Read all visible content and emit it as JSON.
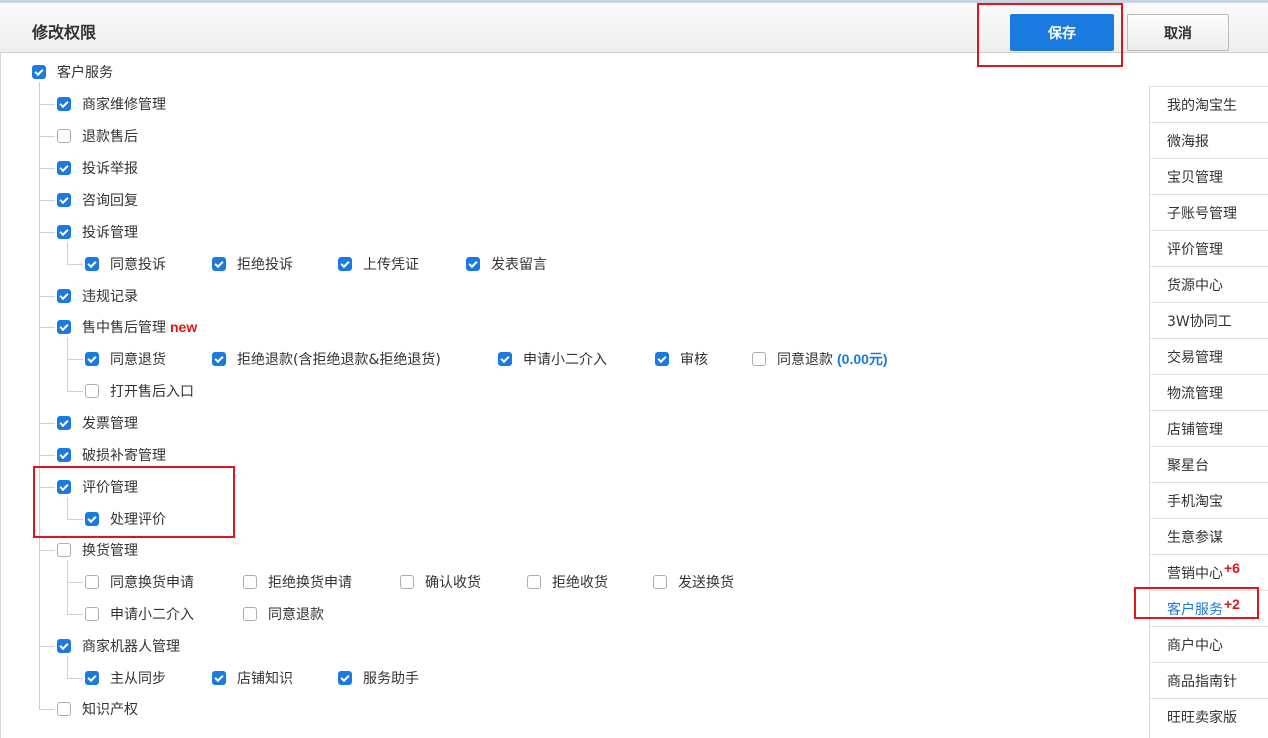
{
  "header": {
    "title": "修改权限",
    "save_label": "保存",
    "cancel_label": "取消"
  },
  "colors": {
    "accent": "#1a7ae0",
    "highlight": "#e0141c",
    "new_tag": "#e0141c"
  },
  "tree": {
    "root": {
      "label": "客户服务",
      "checked": true
    },
    "items": [
      {
        "label": "商家维修管理",
        "checked": true
      },
      {
        "label": "退款售后",
        "checked": false
      },
      {
        "label": "投诉举报",
        "checked": true
      },
      {
        "label": "咨询回复",
        "checked": true
      },
      {
        "label": "投诉管理",
        "checked": true,
        "children": [
          {
            "label": "同意投诉",
            "checked": true
          },
          {
            "label": "拒绝投诉",
            "checked": true
          },
          {
            "label": "上传凭证",
            "checked": true
          },
          {
            "label": "发表留言",
            "checked": true
          }
        ]
      },
      {
        "label": "违规记录",
        "checked": true
      },
      {
        "label": "售中售后管理",
        "badge": "new",
        "checked": true,
        "children": [
          {
            "label": "同意退货",
            "checked": true
          },
          {
            "label": "拒绝退款(含拒绝退款&拒绝退货)",
            "checked": true
          },
          {
            "label": "申请小二介入",
            "checked": true
          },
          {
            "label": "审核",
            "checked": true
          },
          {
            "label": "同意退款",
            "amount": "(0.00元)",
            "checked": false
          },
          {
            "label": "打开售后入口",
            "checked": false
          }
        ]
      },
      {
        "label": "发票管理",
        "checked": true
      },
      {
        "label": "破损补寄管理",
        "checked": true
      },
      {
        "label": "评价管理",
        "checked": true,
        "children": [
          {
            "label": "处理评价",
            "checked": true
          }
        ]
      },
      {
        "label": "换货管理",
        "checked": false,
        "children": [
          {
            "label": "同意换货申请",
            "checked": false
          },
          {
            "label": "拒绝换货申请",
            "checked": false
          },
          {
            "label": "确认收货",
            "checked": false
          },
          {
            "label": "拒绝收货",
            "checked": false
          },
          {
            "label": "发送换货",
            "checked": false
          },
          {
            "label": "申请小二介入",
            "checked": false
          },
          {
            "label": "同意退款",
            "checked": false
          }
        ]
      },
      {
        "label": "商家机器人管理",
        "checked": true,
        "children": [
          {
            "label": "主从同步",
            "checked": true
          },
          {
            "label": "店铺知识",
            "checked": true
          },
          {
            "label": "服务助手",
            "checked": true
          }
        ]
      },
      {
        "label": "知识产权",
        "checked": false
      }
    ]
  },
  "sidebar": {
    "items": [
      {
        "label": "我的淘宝生"
      },
      {
        "label": "微海报"
      },
      {
        "label": "宝贝管理"
      },
      {
        "label": "子账号管理"
      },
      {
        "label": "评价管理"
      },
      {
        "label": "货源中心"
      },
      {
        "label": "3W协同工"
      },
      {
        "label": "交易管理"
      },
      {
        "label": "物流管理"
      },
      {
        "label": "店铺管理"
      },
      {
        "label": "聚星台"
      },
      {
        "label": "手机淘宝"
      },
      {
        "label": "生意参谋"
      },
      {
        "label": "营销中心",
        "badge": "+6"
      },
      {
        "label": "客户服务",
        "badge": "+2",
        "active": true
      },
      {
        "label": "商户中心"
      },
      {
        "label": "商品指南针"
      },
      {
        "label": "旺旺卖家版"
      }
    ]
  }
}
